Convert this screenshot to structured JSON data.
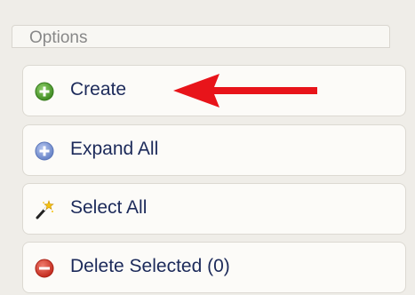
{
  "panel": {
    "title": "Options"
  },
  "options": [
    {
      "label": "Create",
      "icon": "plus-circle-icon",
      "color": "#5a9e35"
    },
    {
      "label": "Expand All",
      "icon": "plus-circle-icon",
      "color": "#7b95d3"
    },
    {
      "label": "Select All",
      "icon": "magic-wand-icon"
    },
    {
      "label": "Delete Selected (0)",
      "icon": "minus-circle-icon",
      "color": "#d13a2c"
    }
  ],
  "annotation": {
    "arrow_color": "#e8141a",
    "points_to": "Create"
  }
}
